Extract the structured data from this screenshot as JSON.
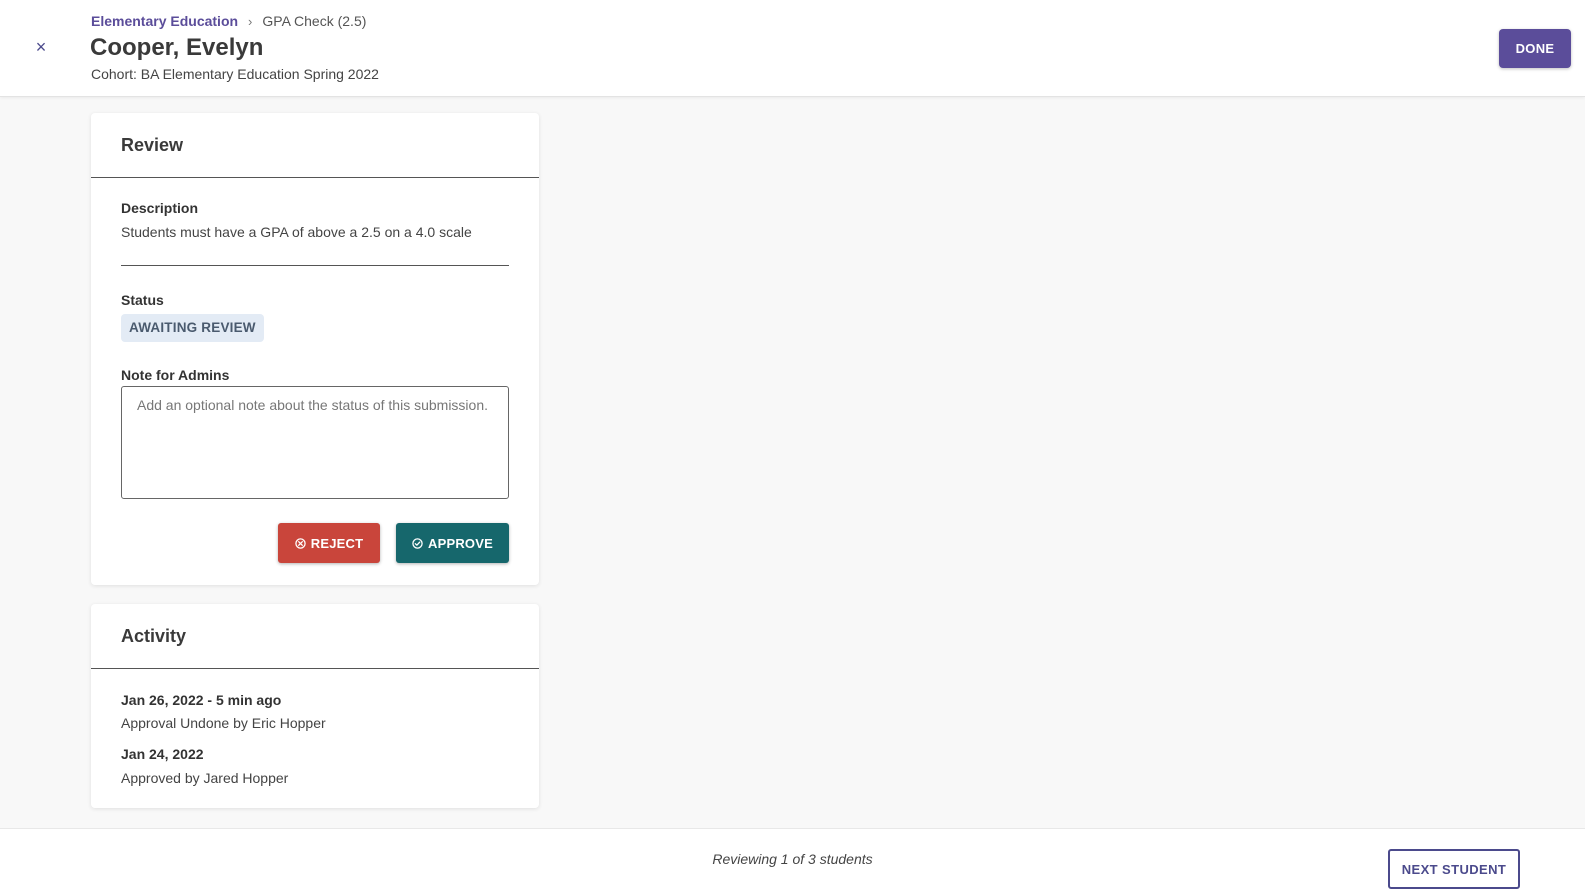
{
  "header": {
    "close_glyph": "×",
    "breadcrumb": {
      "parent": "Elementary Education",
      "separator": "›",
      "current": "GPA Check (2.5)"
    },
    "title": "Cooper, Evelyn",
    "cohort": "Cohort: BA Elementary Education Spring 2022",
    "done_label": "DONE"
  },
  "review": {
    "title": "Review",
    "description_label": "Description",
    "description_text": "Students must have a GPA of above a 2.5 on a 4.0 scale",
    "status_label": "Status",
    "status_value": "AWAITING REVIEW",
    "note_label": "Note for Admins",
    "note_value": "",
    "note_placeholder": "Add an optional note about the status of this submission.",
    "reject_label": "REJECT",
    "approve_label": "APPROVE"
  },
  "activity": {
    "title": "Activity",
    "items": [
      {
        "date": "Jan 26, 2022 - 5 min ago",
        "text": "Approval Undone by Eric Hopper"
      },
      {
        "date": "Jan 24, 2022",
        "text": "Approved by Jared Hopper"
      }
    ]
  },
  "footer": {
    "progress_text": "Reviewing 1 of 3 students",
    "next_label": "NEXT STUDENT"
  },
  "colors": {
    "brand": "#5b4d9a",
    "reject": "#c9453b",
    "approve": "#16676c",
    "status_badge_bg": "#e3ebf5"
  }
}
